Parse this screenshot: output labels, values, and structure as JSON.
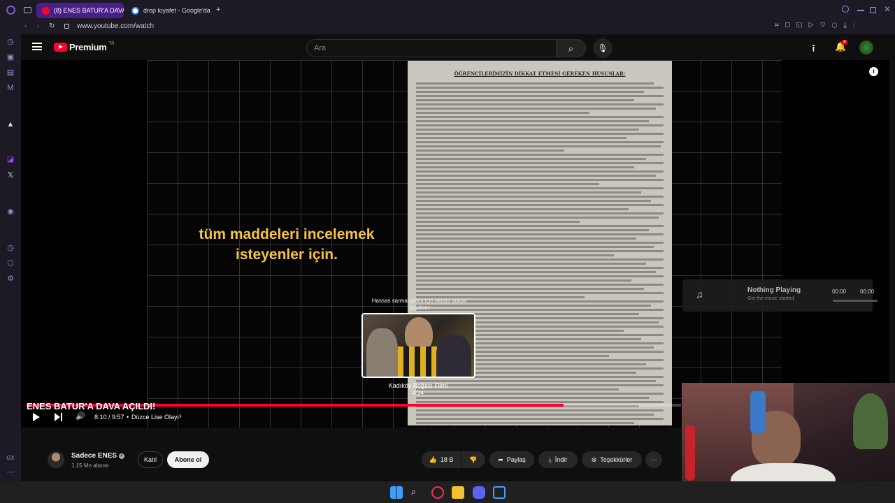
{
  "browser": {
    "tabs": [
      {
        "label": "(8) ENES BATUR'A DAVA",
        "active": true
      },
      {
        "label": "drop kıyafet - Google'da",
        "active": false
      }
    ],
    "url": "www.youtube.com/watch"
  },
  "youtube": {
    "logo_text": "Premium",
    "logo_region": "TR",
    "search_placeholder": "Ara",
    "notification_count": "8"
  },
  "player": {
    "overlay_subtitle": "tüm maddeleri incelemek isteyenler için.",
    "document_heading": "ÖĞRENCİLERİMİZİN DİKKAT ETMESİ GEREKEN HUSUSLAR:",
    "seek_hint": "Hassas sarma işlemi için ekranı yukarı kaydırın",
    "preview_title": "Kadıköy Boğası Filmi",
    "preview_time": "4:34",
    "time_display": "8:10 / 9:57",
    "chapter": "Düzce Lise Olayı",
    "progress": 0.82
  },
  "music_widget": {
    "title": "Nothing Playing",
    "subtitle": "Get the music started",
    "time_left": "00:00",
    "time_right": "00:00"
  },
  "video": {
    "title": "ENES BATUR'A DAVA AÇILDI!",
    "channel": "Sadece ENES",
    "subscribers": "1,15 Mn abone",
    "join_label": "Katıl",
    "subscribe_label": "Abone ol",
    "likes": "18 B",
    "share_label": "Paylaş",
    "download_label": "İndir",
    "thanks_label": "Teşekkürler"
  },
  "colors": {
    "accent": "#ff0033",
    "subtitle": "#f5c542",
    "tab_active": "#4a1f8a"
  }
}
